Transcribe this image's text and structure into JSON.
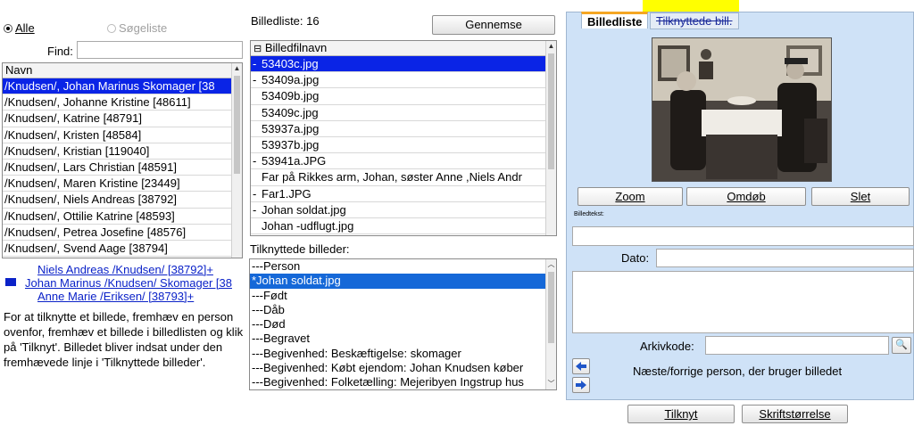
{
  "filter": {
    "all_label": "Alle",
    "search_list_label": "Søgeliste",
    "find_label": "Find:",
    "find_value": ""
  },
  "persons": {
    "header": "Navn",
    "rows": [
      "/Knudsen/, Johan Marinus Skomager [38",
      "/Knudsen/, Johanne Kristine [48611]",
      "/Knudsen/, Katrine [48791]",
      "/Knudsen/, Kristen [48584]",
      "/Knudsen/, Kristian [119040]",
      "/Knudsen/, Lars Christian [48591]",
      "/Knudsen/, Maren Kristine [23449]",
      "/Knudsen/, Niels Andreas [38792]",
      "/Knudsen/, Ottilie Katrine [48593]",
      "/Knudsen/, Petrea Josefine [48576]",
      "/Knudsen/, Svend Aage [38794]"
    ]
  },
  "family": {
    "father": "Niels Andreas /Knudsen/ [38792]+",
    "person": "Johan Marinus /Knudsen/ Skomager [38",
    "mother": "Anne Marie /Eriksen/ [38793]+"
  },
  "help_text": "For at tilknytte et billede, fremhæv en person ovenfor, fremhæv et billede i billedlisten og klik på 'Tilknyt'. Billedet bliver indsat under den fremhævede linje i 'Tilknyttede billeder'.",
  "images": {
    "count_label": "Billedliste: 16",
    "browse_label": "Gennemse",
    "header": "Billedfilnavn",
    "rows": [
      {
        "marker": "-",
        "name": "53403c.jpg"
      },
      {
        "marker": "-",
        "name": "53409a.jpg"
      },
      {
        "marker": "",
        "name": "53409b.jpg"
      },
      {
        "marker": "",
        "name": "53409c.jpg"
      },
      {
        "marker": "",
        "name": "53937a.jpg"
      },
      {
        "marker": "",
        "name": "53937b.jpg"
      },
      {
        "marker": "-",
        "name": "53941a.JPG"
      },
      {
        "marker": "",
        "name": "Far på Rikkes arm, Johan, søster Anne ,Niels Andr"
      },
      {
        "marker": "-",
        "name": "Far1.JPG"
      },
      {
        "marker": "-",
        "name": "Johan soldat.jpg"
      },
      {
        "marker": "",
        "name": "Johan -udflugt.jpg"
      }
    ]
  },
  "attached": {
    "label": "Tilknyttede billeder:",
    "rows": [
      "---Person",
      "*Johan soldat.jpg",
      "---Født",
      "---Dåb",
      "---Død",
      "---Begravet",
      "---Begivenhed: Beskæftigelse: skomager",
      "---Begivenhed: Købt ejendom: Johan Knudsen køber",
      "---Begivenhed: Folketælling: Mejeribyen Ingstrup hus"
    ]
  },
  "right_panel": {
    "tab_active": "Billedliste",
    "tab_inactive": "Tilknyttede bill.",
    "zoom_label": "Zoom",
    "rename_label": "Omdøb",
    "delete_label": "Slet",
    "caption_label": "Billedtekst:",
    "caption_value": "",
    "date_label": "Dato:",
    "date_value": "",
    "notes_value": "",
    "archive_label": "Arkivkode:",
    "archive_value": "",
    "nav_text": "Næste/forrige person, der bruger billedet"
  },
  "bottom": {
    "attach_label": "Tilknyt",
    "font_size_label": "Skriftstørrelse"
  },
  "colors": {
    "selection": "#0a24e6",
    "panel_bg": "#cfe2f7",
    "active_tab": "#f5a623",
    "highlight": "#ffff00",
    "link": "#0b22c8"
  }
}
